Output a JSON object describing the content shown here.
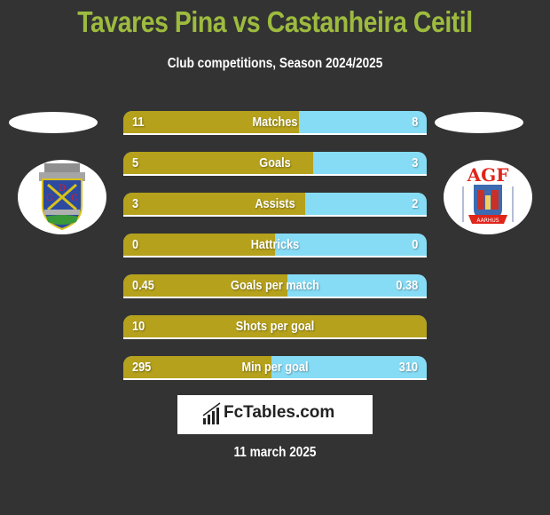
{
  "header": {
    "title": "Tavares Pina vs Castanheira Ceitil",
    "subtitle": "Club competitions, Season 2024/2025"
  },
  "teams": {
    "left": {
      "logo": "gd-chaves-crest-icon"
    },
    "right": {
      "logo": "agf-aarhus-crest-icon"
    }
  },
  "colors": {
    "left_bar": "#b5a11b",
    "right_bar": "#87dcf5",
    "title": "#9dbb3f",
    "background": "#333333"
  },
  "chart_data": {
    "type": "bar",
    "title": "Tavares Pina vs Castanheira Ceitil",
    "subtitle": "Club competitions, Season 2024/2025",
    "categories": [
      "Matches",
      "Goals",
      "Assists",
      "Hattricks",
      "Goals per match",
      "Shots per goal",
      "Min per goal"
    ],
    "series": [
      {
        "name": "Tavares Pina",
        "values": [
          11,
          5,
          3,
          0,
          0.45,
          10,
          295
        ]
      },
      {
        "name": "Castanheira Ceitil",
        "values": [
          8,
          3,
          2,
          0,
          0.38,
          null,
          310
        ]
      }
    ],
    "left_labels": [
      "11",
      "5",
      "3",
      "0",
      "0.45",
      "10",
      "295"
    ],
    "right_labels": [
      "8",
      "3",
      "2",
      "0",
      "0.38",
      "",
      "310"
    ]
  },
  "footer": {
    "brand": "FcTables.com",
    "date": "11 march 2025"
  }
}
